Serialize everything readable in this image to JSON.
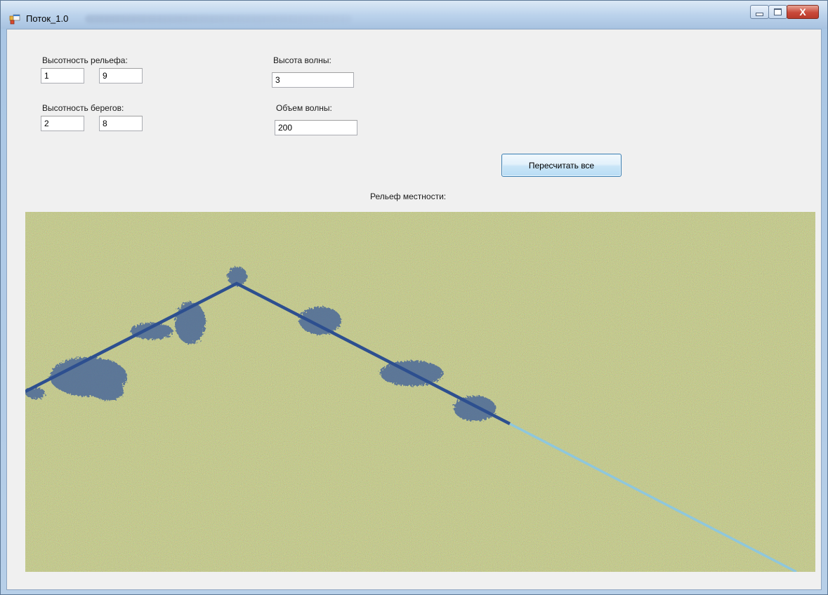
{
  "window": {
    "title": "Поток_1.0",
    "close_glyph": "X"
  },
  "form": {
    "relief_height": {
      "label": "Высотность рельефа:",
      "min": "1",
      "max": "9"
    },
    "bank_height": {
      "label": "Высотность берегов:",
      "min": "2",
      "max": "8"
    },
    "wave_height": {
      "label": "Высота волны:",
      "value": "3"
    },
    "wave_volume": {
      "label": "Объем волны:",
      "value": "200"
    },
    "recalc_button": "Пересчитать все",
    "terrain_label": "Рельеф местности:"
  },
  "icons": {
    "app": "app-window-icon",
    "minimize": "minimize-icon",
    "maximize": "maximize-icon",
    "close": "close-icon"
  },
  "colors": {
    "terrain_green": "#9aa35a",
    "river_dark": "#2d4f8f",
    "river_light": "#8fc7dc",
    "accent": "#3c7fb1"
  }
}
